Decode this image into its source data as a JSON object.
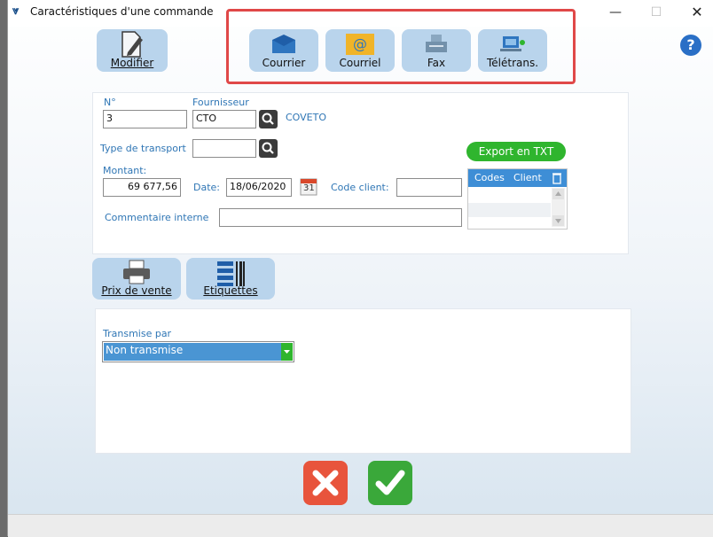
{
  "window": {
    "title": "Caractéristiques d'une commande",
    "close": "✕",
    "minimize": "—",
    "maximize": "☐"
  },
  "toolbar": {
    "modifier": "Modifier",
    "courrier": "Courrier",
    "courriel": "Courriel",
    "fax": "Fax",
    "teletrans": "Télétrans.",
    "help": "?"
  },
  "form": {
    "no_label": "N°",
    "no_value": "3",
    "fournisseur_label": "Fournisseur",
    "fournisseur_code": "CTO",
    "fournisseur_name": "COVETO",
    "transport_label": "Type de transport",
    "transport_value": "",
    "montant_label": "Montant:",
    "montant_value": "69 677,56",
    "date_label": "Date:",
    "date_value": "18/06/2020",
    "calendar_day": "31",
    "code_client_label": "Code client:",
    "code_client_value": "",
    "commentaire_label": "Commentaire interne",
    "commentaire_value": ""
  },
  "export": {
    "label": "Export en TXT",
    "grid_columns": [
      "Codes",
      "Client"
    ]
  },
  "actions": {
    "prix_vente": "Prix de vente",
    "etiquettes": "Etiquettes"
  },
  "transmission": {
    "label": "Transmise par",
    "selected": "Non transmise"
  },
  "colors": {
    "accent_blue": "#3e8ed6",
    "button_bg": "#b9d4ec",
    "label_blue": "#2f76b5",
    "green": "#2fb52e",
    "cancel_red": "#e8543c",
    "highlight_frame": "#e04848"
  }
}
